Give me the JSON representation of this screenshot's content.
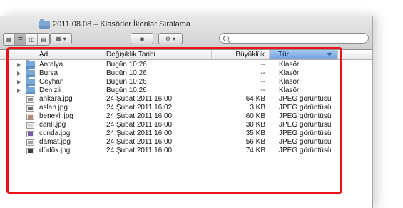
{
  "window": {
    "title": "2011.08.08 – Klasörler İkonlar Sıralama"
  },
  "toolbar": {
    "view_icons": [
      "icon-view-icon",
      "list-view-icon",
      "column-view-icon",
      "coverflow-view-icon"
    ],
    "active_view": "list",
    "arrange_icon": "arrange-icon",
    "quicklook_icon": "eye-icon",
    "action_icon": "gear-icon",
    "search_placeholder": "",
    "search_value": ""
  },
  "columns": {
    "name": "Ad",
    "date": "Değişiklik Tarihi",
    "size": "Büyüklük",
    "kind": "Tür"
  },
  "sorted_column": "kind",
  "files": [
    {
      "name": "Antalya",
      "date": "Bugün 10:26",
      "size": "--",
      "kind": "Klasör",
      "type": "folder"
    },
    {
      "name": "Bursa",
      "date": "Bugün 10:26",
      "size": "--",
      "kind": "Klasör",
      "type": "folder"
    },
    {
      "name": "Ceyhan",
      "date": "Bugün 10:26",
      "size": "--",
      "kind": "Klasör",
      "type": "folder"
    },
    {
      "name": "Denizli",
      "date": "Bugün 10:26",
      "size": "--",
      "kind": "Klasör",
      "type": "folder"
    },
    {
      "name": "ankara.jpg",
      "date": "24 Şubat 2011 16:00",
      "size": "64 KB",
      "kind": "JPEG görüntüsü",
      "type": "jpg",
      "thumb": "#8f8f8f"
    },
    {
      "name": "aslan.jpg",
      "date": "24 Şubat 2011 16:02",
      "size": "3 KB",
      "kind": "JPEG görüntüsü",
      "type": "jpg",
      "thumb": "#6a6a6a"
    },
    {
      "name": "benekli.jpg",
      "date": "24 Şubat 2011 16:00",
      "size": "60 KB",
      "kind": "JPEG görüntüsü",
      "type": "jpg",
      "thumb": "#b48a6a"
    },
    {
      "name": "canlı.jpg",
      "date": "24 Şubat 2011 16:00",
      "size": "30 KB",
      "kind": "JPEG görüntüsü",
      "type": "jpg",
      "thumb": "#d8d8d8"
    },
    {
      "name": "cunda.jpg",
      "date": "24 Şubat 2011 16:00",
      "size": "35 KB",
      "kind": "JPEG görüntüsü",
      "type": "jpg",
      "thumb": "#7d5aa8"
    },
    {
      "name": "damat.jpg",
      "date": "24 Şubat 2011 16:00",
      "size": "56 KB",
      "kind": "JPEG görüntüsü",
      "type": "jpg",
      "thumb": "#a0a0a0"
    },
    {
      "name": "düdük.jpg",
      "date": "24 Şubat 2011 16:00",
      "size": "74 KB",
      "kind": "JPEG görüntüsü",
      "type": "jpg",
      "thumb": "#3c3c46"
    }
  ],
  "colors": {
    "highlight_border": "#e8141d",
    "sorted_header": "#6f9fdb",
    "folder": "#78a6d6"
  }
}
